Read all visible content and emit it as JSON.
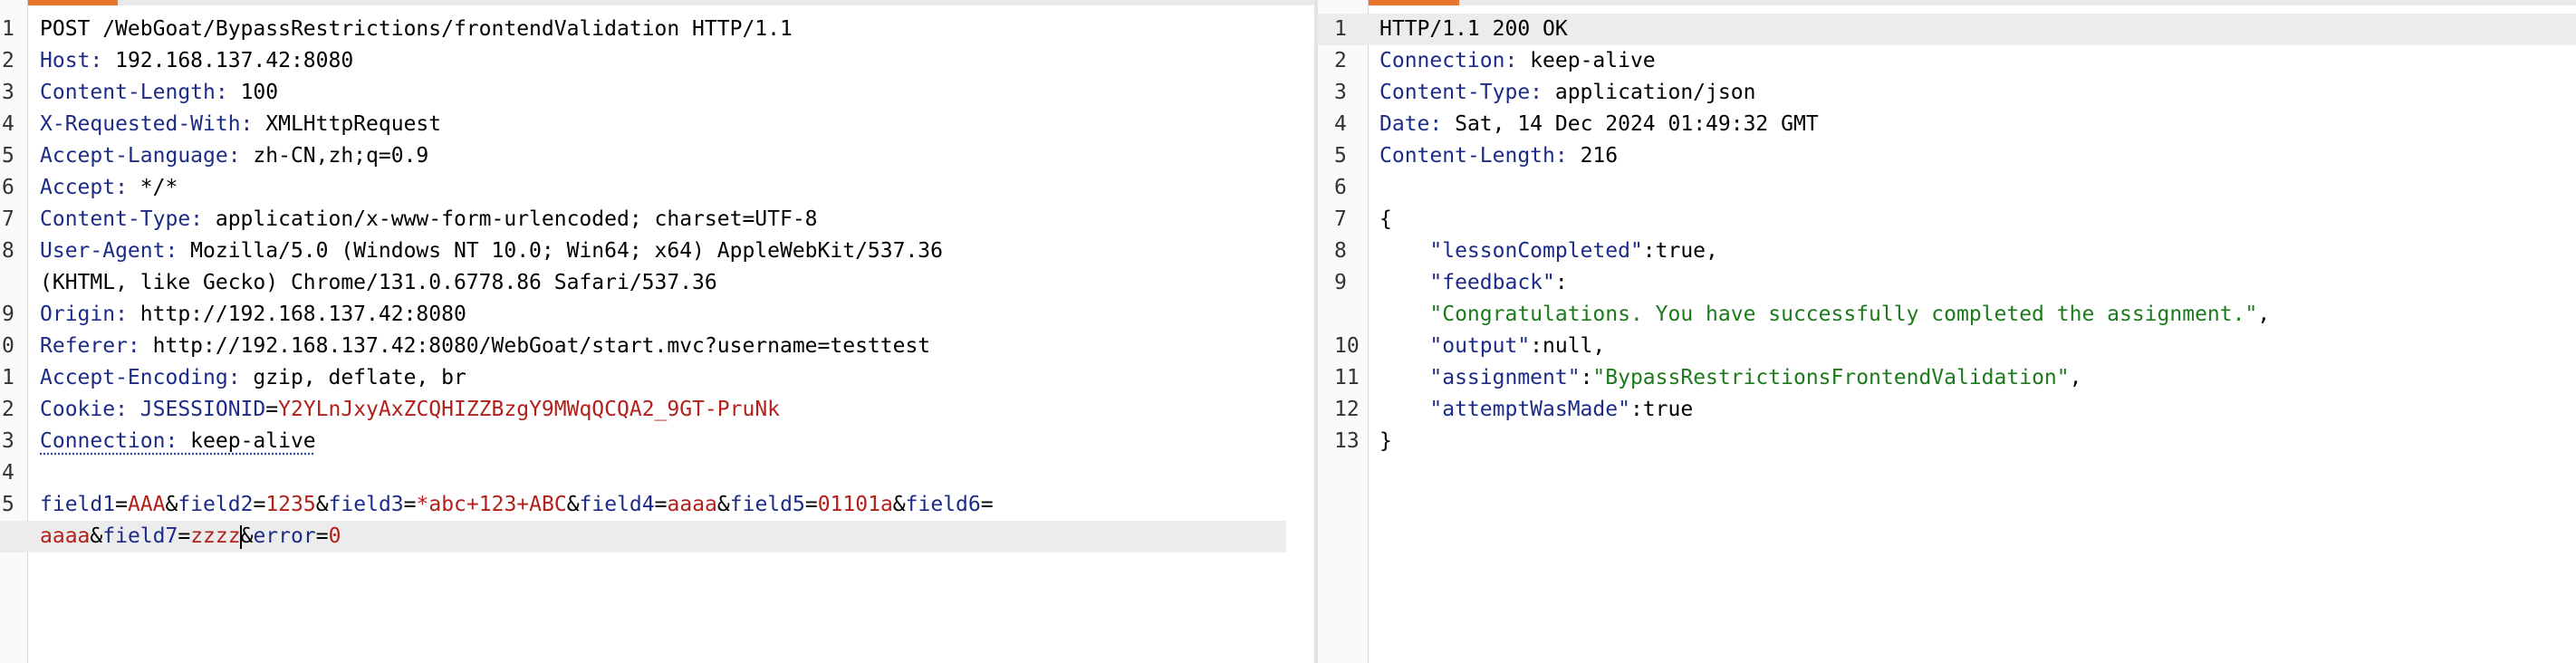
{
  "request": {
    "lines": [
      {
        "n": "1",
        "parts": [
          {
            "t": "POST /WebGoat/BypassRestrictions/frontendValidation HTTP/1.1",
            "c": "plain"
          }
        ]
      },
      {
        "n": "2",
        "parts": [
          {
            "t": "Host:",
            "c": "header-name"
          },
          {
            "t": " 192.168.137.42:8080",
            "c": "plain"
          }
        ]
      },
      {
        "n": "3",
        "parts": [
          {
            "t": "Content-Length:",
            "c": "header-name"
          },
          {
            "t": " 100",
            "c": "plain"
          }
        ]
      },
      {
        "n": "4",
        "parts": [
          {
            "t": "X-Requested-With:",
            "c": "header-name"
          },
          {
            "t": " XMLHttpRequest",
            "c": "plain"
          }
        ]
      },
      {
        "n": "5",
        "parts": [
          {
            "t": "Accept-Language:",
            "c": "header-name"
          },
          {
            "t": " zh-CN,zh;q=0.9",
            "c": "plain"
          }
        ]
      },
      {
        "n": "6",
        "parts": [
          {
            "t": "Accept:",
            "c": "header-name"
          },
          {
            "t": " */*",
            "c": "plain"
          }
        ]
      },
      {
        "n": "7",
        "parts": [
          {
            "t": "Content-Type:",
            "c": "header-name"
          },
          {
            "t": " application/x-www-form-urlencoded; charset=UTF-8",
            "c": "plain"
          }
        ]
      },
      {
        "n": "8",
        "parts": [
          {
            "t": "User-Agent:",
            "c": "header-name"
          },
          {
            "t": " Mozilla/5.0 (Windows NT 10.0; Win64; x64) AppleWebKit/537.36",
            "c": "plain"
          }
        ]
      },
      {
        "n": "",
        "parts": [
          {
            "t": "(KHTML, like Gecko) Chrome/131.0.6778.86 Safari/537.36",
            "c": "plain"
          }
        ]
      },
      {
        "n": "9",
        "parts": [
          {
            "t": "Origin:",
            "c": "header-name"
          },
          {
            "t": " http://192.168.137.42:8080",
            "c": "plain"
          }
        ]
      },
      {
        "n": "0",
        "parts": [
          {
            "t": "Referer:",
            "c": "header-name"
          },
          {
            "t": " http://192.168.137.42:8080/WebGoat/start.mvc?username=testtest",
            "c": "plain"
          }
        ]
      },
      {
        "n": "1",
        "parts": [
          {
            "t": "Accept-Encoding:",
            "c": "header-name"
          },
          {
            "t": " gzip, deflate, br",
            "c": "plain"
          }
        ]
      },
      {
        "n": "2",
        "parts": [
          {
            "t": "Cookie:",
            "c": "header-name"
          },
          {
            "t": " JSESSIONID",
            "c": "param"
          },
          {
            "t": "=",
            "c": "plain"
          },
          {
            "t": "Y2YLnJxyAxZCQHIZZBzgY9MWqQCQA2_9GT-PruNk",
            "c": "red"
          }
        ]
      },
      {
        "n": "3",
        "parts": [
          {
            "t": "Connection:",
            "c": "header-name",
            "u": true
          },
          {
            "t": " keep-alive",
            "c": "plain",
            "u": true
          }
        ]
      },
      {
        "n": "4",
        "parts": []
      },
      {
        "n": "5",
        "parts": [
          {
            "t": "field1",
            "c": "param"
          },
          {
            "t": "=",
            "c": "plain"
          },
          {
            "t": "AAA",
            "c": "red"
          },
          {
            "t": "&",
            "c": "plain"
          },
          {
            "t": "field2",
            "c": "param"
          },
          {
            "t": "=",
            "c": "plain"
          },
          {
            "t": "1235",
            "c": "red"
          },
          {
            "t": "&",
            "c": "plain"
          },
          {
            "t": "field3",
            "c": "param"
          },
          {
            "t": "=",
            "c": "plain"
          },
          {
            "t": "*abc+123+ABC",
            "c": "red"
          },
          {
            "t": "&",
            "c": "plain"
          },
          {
            "t": "field4",
            "c": "param"
          },
          {
            "t": "=",
            "c": "plain"
          },
          {
            "t": "aaaa",
            "c": "red"
          },
          {
            "t": "&",
            "c": "plain"
          },
          {
            "t": "field5",
            "c": "param"
          },
          {
            "t": "=",
            "c": "plain"
          },
          {
            "t": "01101a",
            "c": "red"
          },
          {
            "t": "&",
            "c": "plain"
          },
          {
            "t": "field6",
            "c": "param"
          },
          {
            "t": "=",
            "c": "plain"
          }
        ]
      },
      {
        "n": "",
        "hl": true,
        "parts": [
          {
            "t": "aaaa",
            "c": "red"
          },
          {
            "t": "&",
            "c": "plain"
          },
          {
            "t": "field7",
            "c": "param"
          },
          {
            "t": "=",
            "c": "plain"
          },
          {
            "t": "zzzz",
            "c": "red"
          },
          {
            "t": "",
            "c": "caret"
          },
          {
            "t": "&",
            "c": "plain"
          },
          {
            "t": "error",
            "c": "param"
          },
          {
            "t": "=",
            "c": "plain"
          },
          {
            "t": "0",
            "c": "red"
          }
        ]
      }
    ]
  },
  "response": {
    "lines": [
      {
        "n": "1",
        "hl": true,
        "parts": [
          {
            "t": "HTTP/1.1 200 OK",
            "c": "plain"
          }
        ]
      },
      {
        "n": "2",
        "parts": [
          {
            "t": "Connection:",
            "c": "header-name"
          },
          {
            "t": " keep-alive",
            "c": "plain"
          }
        ]
      },
      {
        "n": "3",
        "parts": [
          {
            "t": "Content-Type:",
            "c": "header-name"
          },
          {
            "t": " application/json",
            "c": "plain"
          }
        ]
      },
      {
        "n": "4",
        "parts": [
          {
            "t": "Date:",
            "c": "header-name"
          },
          {
            "t": " Sat, 14 Dec 2024 01:49:32 GMT",
            "c": "plain"
          }
        ]
      },
      {
        "n": "5",
        "parts": [
          {
            "t": "Content-Length:",
            "c": "header-name"
          },
          {
            "t": " 216",
            "c": "plain"
          }
        ]
      },
      {
        "n": "6",
        "parts": []
      },
      {
        "n": "7",
        "parts": [
          {
            "t": "{",
            "c": "plain"
          }
        ]
      },
      {
        "n": "8",
        "parts": [
          {
            "t": "    ",
            "c": "plain"
          },
          {
            "t": "\"lessonCompleted\"",
            "c": "json-key"
          },
          {
            "t": ":true,",
            "c": "json-plain"
          }
        ]
      },
      {
        "n": "9",
        "parts": [
          {
            "t": "    ",
            "c": "plain"
          },
          {
            "t": "\"feedback\"",
            "c": "json-key"
          },
          {
            "t": ":",
            "c": "json-plain"
          }
        ]
      },
      {
        "n": "",
        "parts": [
          {
            "t": "    ",
            "c": "plain"
          },
          {
            "t": "\"Congratulations. You have successfully completed the assignment.\"",
            "c": "json-str"
          },
          {
            "t": ",",
            "c": "json-plain"
          }
        ]
      },
      {
        "n": "10",
        "parts": [
          {
            "t": "    ",
            "c": "plain"
          },
          {
            "t": "\"output\"",
            "c": "json-key"
          },
          {
            "t": ":null,",
            "c": "json-plain"
          }
        ]
      },
      {
        "n": "11",
        "parts": [
          {
            "t": "    ",
            "c": "plain"
          },
          {
            "t": "\"assignment\"",
            "c": "json-key"
          },
          {
            "t": ":",
            "c": "json-plain"
          },
          {
            "t": "\"BypassRestrictionsFrontendValidation\"",
            "c": "json-str"
          },
          {
            "t": ",",
            "c": "json-plain"
          }
        ]
      },
      {
        "n": "12",
        "parts": [
          {
            "t": "    ",
            "c": "plain"
          },
          {
            "t": "\"attemptWasMade\"",
            "c": "json-key"
          },
          {
            "t": ":true",
            "c": "json-plain"
          }
        ]
      },
      {
        "n": "13",
        "parts": [
          {
            "t": "}",
            "c": "plain"
          }
        ]
      }
    ]
  }
}
